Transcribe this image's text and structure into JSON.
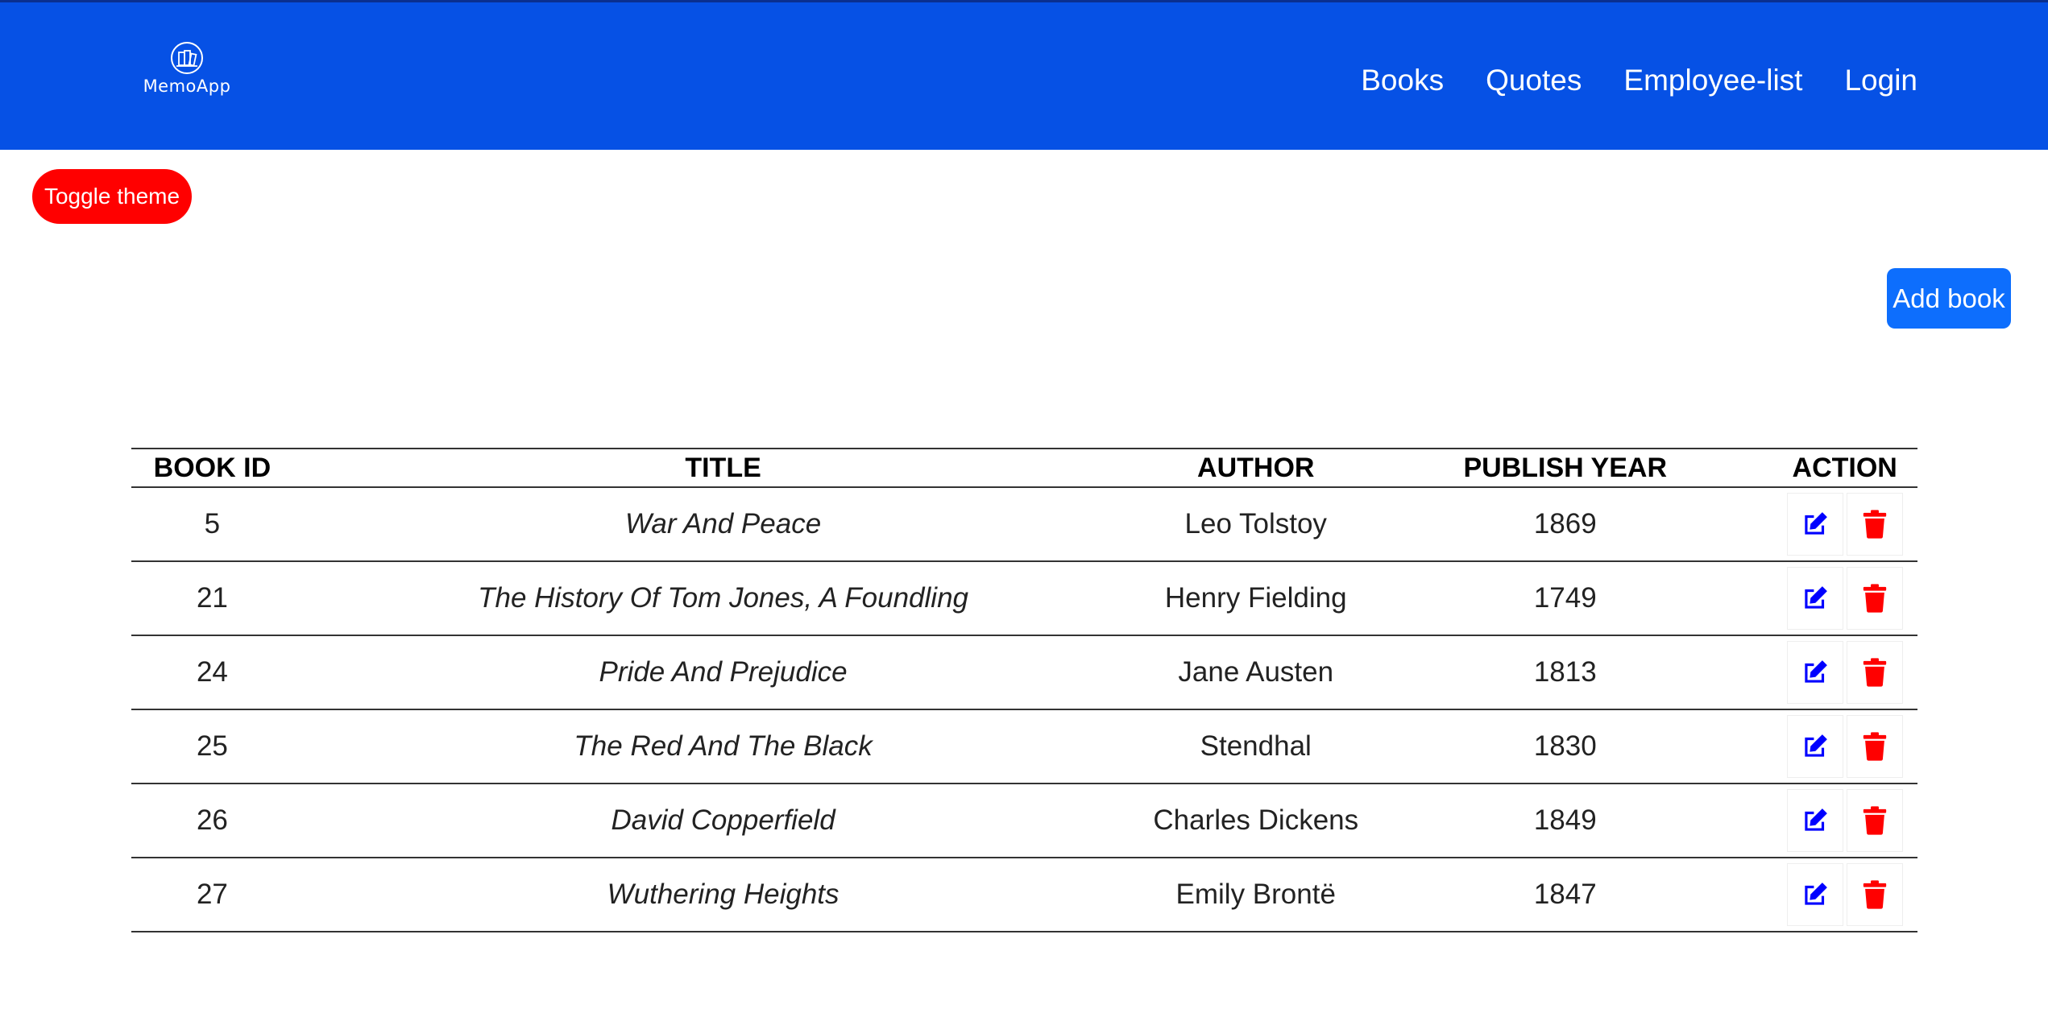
{
  "brand": {
    "name": "MemoApp",
    "icon": "books-logo-icon"
  },
  "nav": {
    "items": [
      {
        "label": "Books"
      },
      {
        "label": "Quotes"
      },
      {
        "label": "Employee-list"
      },
      {
        "label": "Login"
      }
    ]
  },
  "buttons": {
    "toggle_theme": "Toggle theme",
    "add_book": "Add book"
  },
  "colors": {
    "navbar": "#0651e5",
    "toggle_button": "#ff0000",
    "add_button": "#0d6efd",
    "edit_icon": "#0000ff",
    "delete_icon": "#ff0000"
  },
  "table": {
    "columns": [
      "BOOK ID",
      "TITLE",
      "AUTHOR",
      "PUBLISH YEAR",
      "ACTION"
    ],
    "rows": [
      {
        "id": "5",
        "title": "War And Peace",
        "author": "Leo Tolstoy",
        "year": "1869"
      },
      {
        "id": "21",
        "title": "The History Of Tom Jones, A Foundling",
        "author": "Henry Fielding",
        "year": "1749"
      },
      {
        "id": "24",
        "title": "Pride And Prejudice",
        "author": "Jane Austen",
        "year": "1813"
      },
      {
        "id": "25",
        "title": "The Red And The Black",
        "author": "Stendhal",
        "year": "1830"
      },
      {
        "id": "26",
        "title": "David Copperfield",
        "author": "Charles Dickens",
        "year": "1849"
      },
      {
        "id": "27",
        "title": "Wuthering Heights",
        "author": "Emily Brontë",
        "year": "1847"
      }
    ],
    "row_actions": [
      "edit-icon",
      "trash-icon"
    ]
  }
}
